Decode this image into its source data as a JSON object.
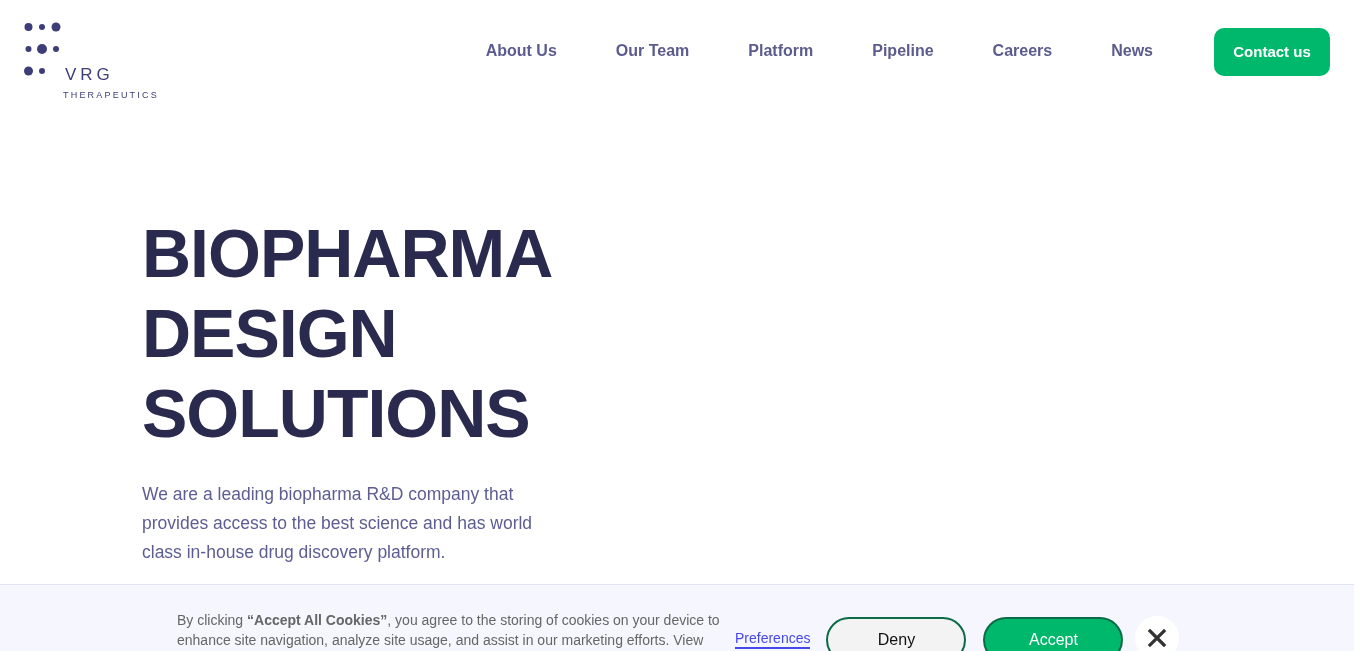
{
  "logo": {
    "name": "VRG",
    "tagline": "THERAPEUTICS"
  },
  "nav": {
    "links": [
      "About Us",
      "Our Team",
      "Platform",
      "Pipeline",
      "Careers",
      "News"
    ],
    "cta": "Contact us"
  },
  "hero": {
    "heading_lines": [
      "BIOPHARMA",
      "DESIGN",
      "SOLUTIONS"
    ],
    "text": "We are a leading biopharma R&D company that provides access to the best science and has world class in-house drug discovery platform."
  },
  "cookie_banner": {
    "text": "By clicking **“Accept All Cookies”**, you agree to the storing of cookies on your device to enhance site navigation, analyze site usage, and assist in our marketing efforts. View",
    "preferences": "Preferences",
    "buttons": [
      {
        "label": "Deny",
        "kind": "secondary"
      },
      {
        "label": "Accept",
        "kind": "primary"
      }
    ]
  }
}
